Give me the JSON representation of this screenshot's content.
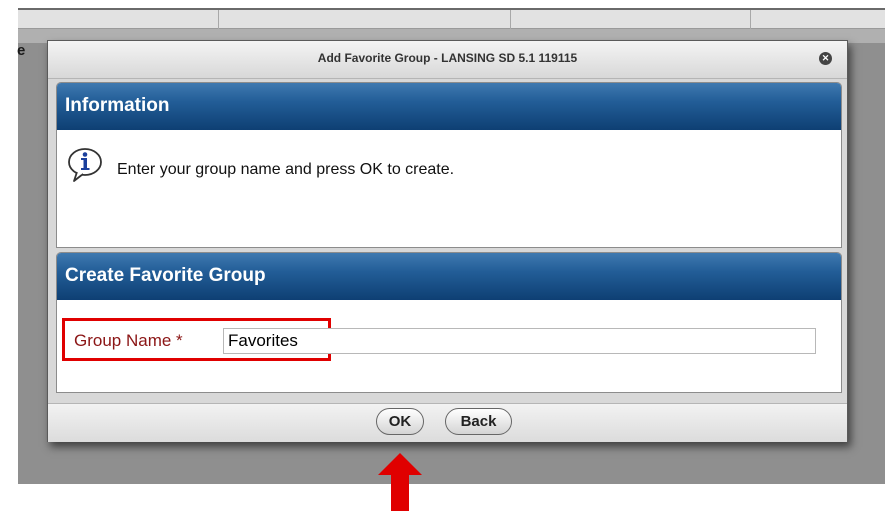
{
  "background": {
    "partial_header_letter": "e"
  },
  "dialog": {
    "title": "Add Favorite Group - LANSING SD 5.1 119115",
    "close_icon": "close-icon",
    "info_panel": {
      "heading": "Information",
      "icon": "info-speech-bubble-icon",
      "message": "Enter your group name and press OK to create."
    },
    "create_panel": {
      "heading": "Create Favorite Group",
      "group_name_label": "Group Name *",
      "group_name_value": "Favorites"
    },
    "buttons": {
      "ok": "OK",
      "back": "Back"
    }
  },
  "annotations": {
    "highlight_color": "#e00000",
    "arrow_color": "#e00000",
    "arrow_icon": "up-arrow-icon"
  },
  "colors": {
    "panel_header": "#1a4f86",
    "label_text": "#8b1515"
  }
}
